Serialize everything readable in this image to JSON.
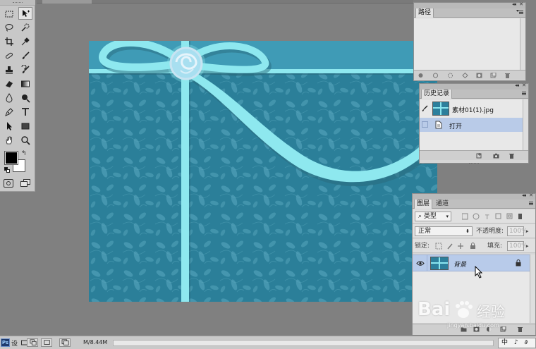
{
  "document_tab": {
    "label": ""
  },
  "toolbox": {
    "tools": [
      "rect-marquee",
      "move",
      "lasso",
      "quick-select",
      "crop",
      "eyedropper",
      "healing-brush",
      "brush",
      "clone-stamp",
      "history-brush",
      "eraser",
      "gradient",
      "blur",
      "dodge",
      "pen",
      "type",
      "path-select",
      "rectangle-shape",
      "hand",
      "zoom"
    ],
    "foreground_color": "#000000",
    "background_color": "#ffffff"
  },
  "canvas": {
    "background_color": "#2b7f99",
    "pattern_color": "#5aa9c0",
    "ribbon_color": "#8ee8ef",
    "ribbon_shadow": "#2a6b7e"
  },
  "paths_panel": {
    "tab": "路径"
  },
  "history_panel": {
    "tab": "历史记录",
    "snapshot_label": "素材01(1).jpg",
    "steps": [
      {
        "label": "打开"
      }
    ]
  },
  "layers_panel": {
    "tabs": [
      "图层",
      "通道"
    ],
    "filter_kind": "类型",
    "blend_mode": "正常",
    "opacity_label": "不透明度:",
    "opacity_value": "100%",
    "lock_label": "锁定:",
    "fill_label": "填充:",
    "fill_value": "100%",
    "layers": [
      {
        "name": "背景",
        "visible": true,
        "locked": true
      }
    ]
  },
  "status_bar": {
    "ps_label": "Ps",
    "side_label": "设",
    "doc_size": "M/8.44M",
    "ime": "中 ♪ ∂"
  },
  "watermark": {
    "brand": "Bai",
    "brand_cn": "经验",
    "url": "jingyan.baidu.com"
  }
}
